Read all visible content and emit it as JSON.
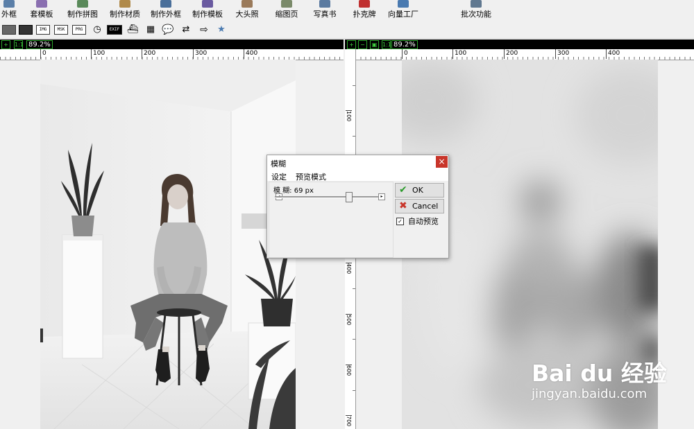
{
  "toolbar": {
    "items": [
      {
        "label": "外框"
      },
      {
        "label": "套模板"
      },
      {
        "label": "制作拼图"
      },
      {
        "label": "制作材质"
      },
      {
        "label": "制作外框"
      },
      {
        "label": "制作模板"
      },
      {
        "label": "大头照"
      },
      {
        "label": "缩图页"
      },
      {
        "label": "写真书"
      },
      {
        "label": "扑克牌"
      },
      {
        "label": "向量工厂"
      },
      {
        "label": "批次功能"
      }
    ]
  },
  "toolbar2": {
    "buttons": [
      {
        "icon": "image-icon"
      },
      {
        "icon": "frame-icon"
      },
      {
        "label": "IMG"
      },
      {
        "label": "MSK"
      },
      {
        "label": "PRG"
      },
      {
        "icon": "clock-icon"
      },
      {
        "label": "EXIF"
      },
      {
        "icon": "ship-icon"
      },
      {
        "icon": "calendar-icon"
      },
      {
        "icon": "speech-bubble-icon"
      },
      {
        "icon": "swap-arrows-icon"
      },
      {
        "icon": "arrow-right-icon"
      },
      {
        "icon": "star-arrow-icon"
      }
    ]
  },
  "left_view": {
    "zoom": "89.2%",
    "ruler_labels": [
      "0",
      "100",
      "200",
      "300",
      "400"
    ]
  },
  "right_view": {
    "zoom": "89.2%",
    "ruler_labels": [
      "0",
      "100",
      "200",
      "300",
      "400"
    ],
    "vruler_labels": [
      "100",
      "400",
      "500",
      "600",
      "700"
    ]
  },
  "dialog": {
    "title": "模糊",
    "close_symbol": "×",
    "tabs": [
      "设定",
      "预览模式"
    ],
    "slider_label": "模 糊: 69 px",
    "slider_value": 69,
    "ok_label": "OK",
    "cancel_label": "Cancel",
    "auto_preview_label": "自动预览",
    "auto_preview_checked": true
  },
  "watermark": {
    "brand": "Bai du 经验",
    "url": "jingyan.baidu.com"
  },
  "colors": {
    "dialog_close": "#c8352a",
    "zoom_border": "#2ea82e"
  }
}
